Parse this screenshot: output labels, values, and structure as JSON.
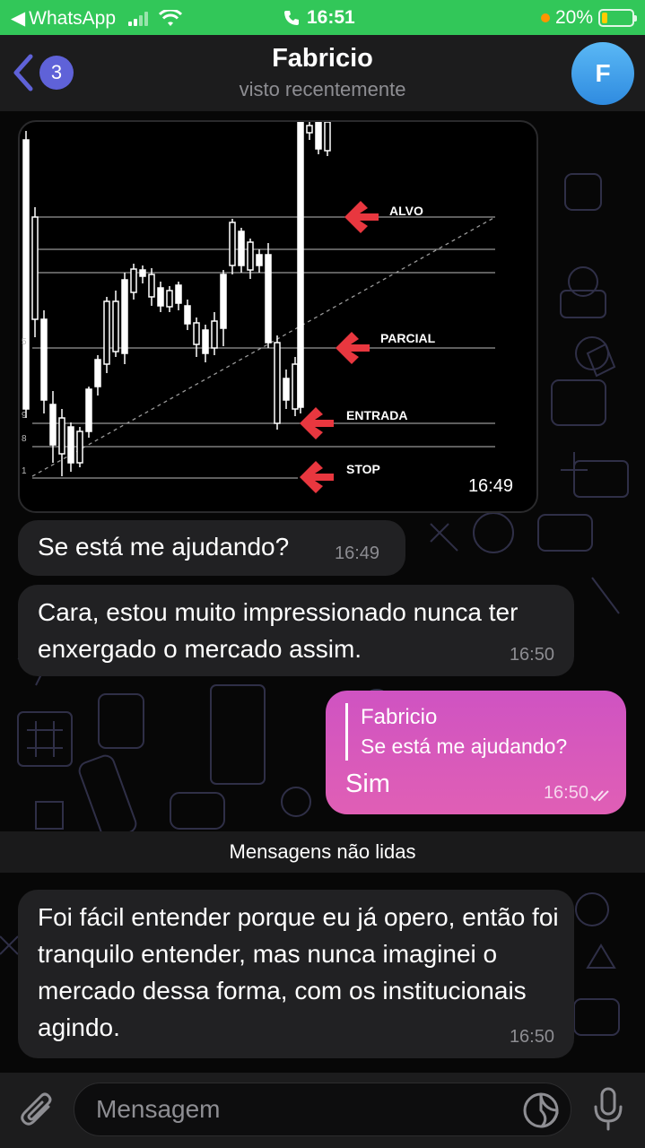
{
  "status_bar": {
    "back_app": "WhatsApp",
    "time": "16:51",
    "battery": "20%",
    "battery_level": 0.2,
    "colors": {
      "background": "#32c759",
      "battery_fill": "#ffcc00",
      "dot": "#ff9500"
    }
  },
  "header": {
    "unread_count": "3",
    "title": "Fabricio",
    "subtitle": "visto recentemente",
    "avatar_letter": "F",
    "accent": "#5f62d8"
  },
  "chart_image": {
    "labels": {
      "alvo": "ALVO",
      "parcial": "PARCIAL",
      "entrada": "ENTRADA",
      "stop": "STOP"
    },
    "axis_marks": [
      "5",
      "9",
      "8",
      "1"
    ],
    "time": "16:49"
  },
  "messages": [
    {
      "text": "Se está me ajudando?",
      "time": "16:49"
    },
    {
      "text": "Cara, estou muito impressionado nunca ter enxergado o mercado assim.",
      "time": "16:50"
    },
    {
      "reply_name": "Fabricio",
      "reply_text": "Se está me ajudando?",
      "text": "Sim",
      "time": "16:50"
    },
    {
      "text": "Foi fácil entender porque eu já opero, então foi tranquilo entender, mas nunca imaginei o mercado dessa forma, com os institucionais agindo.",
      "time": "16:50"
    }
  ],
  "unread_separator": "Mensagens não lidas",
  "input": {
    "placeholder": "Mensagem"
  },
  "icons": [
    "back-chevron-icon",
    "signal-icon",
    "wifi-icon",
    "phone-icon",
    "battery-icon",
    "attach-icon",
    "sticker-icon",
    "microphone-icon",
    "double-check-icon",
    "arrow-icon"
  ]
}
